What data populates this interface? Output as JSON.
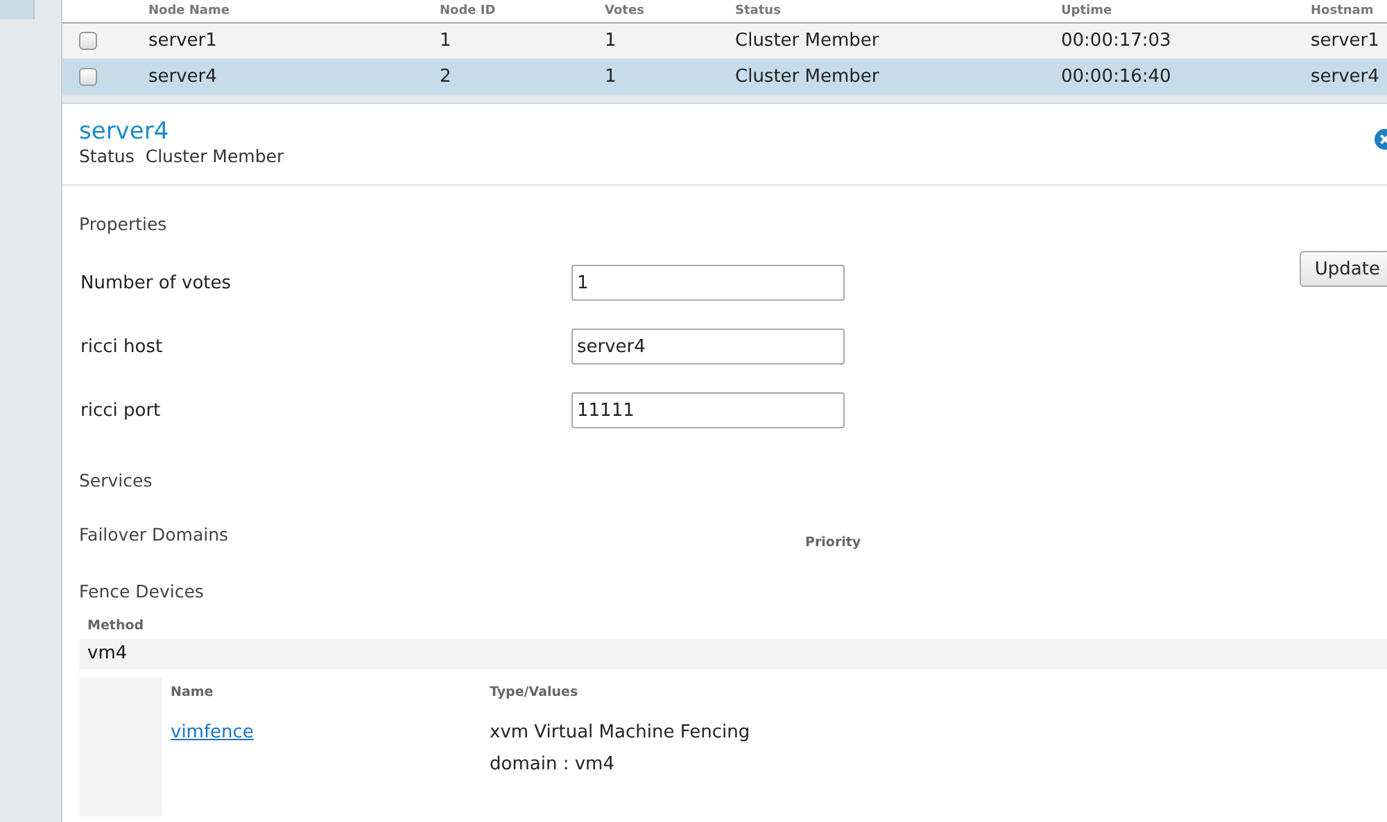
{
  "table": {
    "columns": [
      "Node Name",
      "Node ID",
      "Votes",
      "Status",
      "Uptime",
      "Hostnam"
    ],
    "rows": [
      {
        "selected": false,
        "checked": false,
        "cells": [
          "server1",
          "1",
          "1",
          "Cluster Member",
          "00:00:17:03",
          "server1"
        ]
      },
      {
        "selected": true,
        "checked": false,
        "cells": [
          "server4",
          "2",
          "1",
          "Cluster Member",
          "00:00:16:40",
          "server4"
        ]
      }
    ]
  },
  "detail": {
    "title": "server4",
    "status_label": "Status",
    "status": "Cluster Member",
    "properties_heading": "Properties",
    "fields": [
      {
        "label": "Number of votes",
        "value": "1"
      },
      {
        "label": "ricci host",
        "value": "server4"
      },
      {
        "label": "ricci port",
        "value": "11111"
      }
    ],
    "update_button": "Update",
    "services_heading": "Services",
    "failover_heading": "Failover Domains",
    "failover_priority_header": "Priority",
    "fence_heading": "Fence Devices",
    "method_header": "Method",
    "method": "vm4",
    "device_columns": [
      "Name",
      "Type/Values"
    ],
    "devices": [
      {
        "name": "vimfence",
        "type": "xvm Virtual Machine Fencing",
        "values": [
          "domain : vm4"
        ]
      }
    ]
  }
}
